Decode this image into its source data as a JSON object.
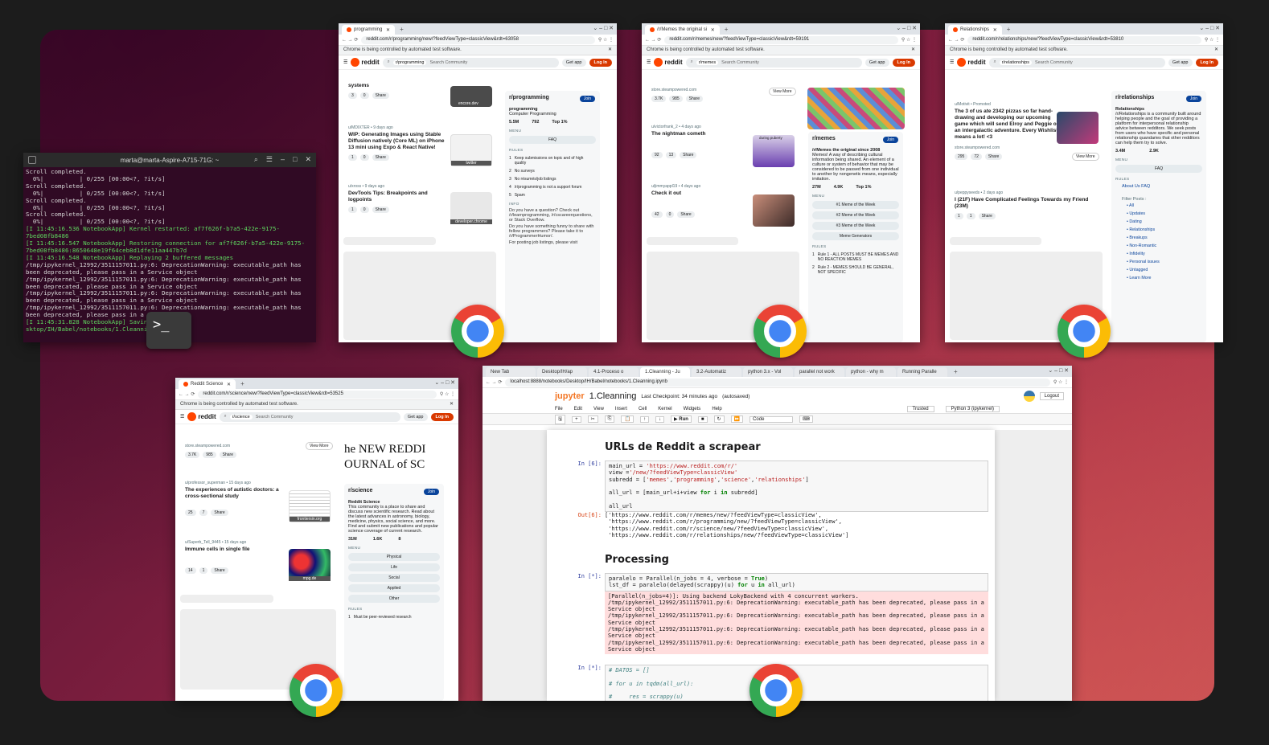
{
  "terminal": {
    "title": "marta@marta-Aspire-A715-71G: ~",
    "lines": [
      "Scroll completed.",
      "  0%|          | 0/255 [00:00<?, ?it/s]",
      "Scroll completed.",
      "  0%|          | 0/255 [00:00<?, ?it/s]",
      "Scroll completed.",
      "  0%|          | 0/255 [00:00<?, ?it/s]",
      "Scroll completed.",
      "  0%|          | 0/255 [00:00<?, ?it/s]",
      "[I 11:45:16.536 NotebookApp] Kernel restarted: af7f626f-b7a5-422e-9175-7bed08fb8486",
      "[I 11:45:16.547 NotebookApp] Restoring connection for af7f626f-b7a5-422e-9175-7bed08fb8486:8650648e19f64ceb8d1dfe11aa447b7d",
      "[I 11:45:16.548 NotebookApp] Replaying 2 buffered messages",
      "/tmp/ipykernel_12992/3511157011.py:6: DeprecationWarning: executable_path has been deprecated, please pass in a Service object",
      "/tmp/ipykernel_12992/3511157011.py:6: DeprecationWarning: executable_path has been deprecated, please pass in a Service object",
      "/tmp/ipykernel_12992/3511157011.py:6: DeprecationWarning: executable_path has been deprecated, please pass in a Service object",
      "/tmp/ipykernel_12992/3511157011.py:6: DeprecationWarning: executable_path has been deprecated, please pass in a Se",
      "[I 11:45:31.828 NotebookApp] Saving          sktop/IH/Babel/notebooks/1.Cleanning.ipynb"
    ],
    "icon": "terminal-icon"
  },
  "common": {
    "infobar": "Chrome is being controlled by automated test software.",
    "reddit": "reddit",
    "search": "Search Community",
    "getapp": "Get app",
    "login": "Log In",
    "join": "Join",
    "share": "Share",
    "menu": "MENU",
    "rules": "RULES",
    "faq": "FAQ"
  },
  "programming": {
    "tab": "programming",
    "url": "reddit.com/r/programming/new/?feedViewType=classicView&rdt=63058",
    "chip": "r/programming",
    "post0_title": "systems",
    "post0_counts": [
      "3",
      "0"
    ],
    "post0_thumb": "encore.dev",
    "post1_meta": "u/MDIXTER • 9 days ago",
    "post1_title": "WIP: Generating Images using Stable Diffusion natively (Core ML) on iPhone 13 mini using Expo & React Native!",
    "post1_counts": [
      "1",
      "0"
    ],
    "post1_thumb": "twitter",
    "post2_meta": "u/xross • 9 days ago",
    "post2_title": "DevTools Tips: Breakpoints and logpoints",
    "post2_counts": [
      "1",
      "0"
    ],
    "post2_thumb": "developer.chrome",
    "side_title": "r/programming",
    "side_name": "programming",
    "side_desc": "Computer Programming",
    "members": "5.5M",
    "online": "792",
    "rank": "Top 1%",
    "rules": [
      "Keep submissions on topic and of high quality",
      "No surveys",
      "No résumés/job listings",
      "/r/programming is not a support forum",
      "Spam"
    ],
    "info_head": "INFO",
    "info1": "Do you have a question? Check out /r/learnprogramming, /r/cscareerquestions, or Stack Overflow.",
    "info2": "Do you have something funny to share with fellow programmers? Please take it to /r/ProgrammerHumor/.",
    "info3": "For posting job listings, please visit"
  },
  "memes": {
    "tab": "/r/Memes the original si",
    "url": "reddit.com/r/memes/new/?feedViewType=classicView&rdt=59191",
    "chip": "r/memes",
    "domain": "store.steampowered.com",
    "viewmore": "View More",
    "post0_counts": [
      "3.7K",
      "985"
    ],
    "post1_meta": "u/victorfrank_2 • 4 days ago",
    "post1_title": "The nightman cometh",
    "post1_counts": [
      "92",
      "13"
    ],
    "post1_thumb": "during puberty",
    "post2_meta": "u/jimmyappl19 • 4 days ago",
    "post2_title": "Check it out",
    "post2_counts": [
      "42",
      "0"
    ],
    "side_title": "r/memes",
    "side_name": "/r/Memes the original since 2008",
    "side_desc": "Memes! A way of describing cultural information being shared. An element of a culture or system of behavior that may be considered to be passed from one individual to another by nongenetic means, especially imitation.",
    "members": "27M",
    "online": "4.9K",
    "rank": "Top 1%",
    "menu_items": [
      "#1 Meme of the Week",
      "#2 Meme of the Week",
      "#3 Meme of the Week",
      "Meme Generators"
    ],
    "rules": [
      "Rule 1 - ALL POSTS MUST BE MEMES AND NO REACTION MEMES",
      "Rule 2 - MEMES SHOULD BE GENERAL, NOT SPECIFIC"
    ]
  },
  "relationships": {
    "tab": "Relationships",
    "url": "reddit.com/r/relationships/new/?feedViewType=classicView&rdt=53810",
    "chip": "r/relationships",
    "post1_meta": "u/Motivit • Promoted",
    "post1_title": "The 3 of us ate 2342 pizzas so far hand-drawing and developing our upcoming game which will send Elroy and Peggie on an intergalactic adventure. Every Wishlist means a lot! <3",
    "domain": "store.steampowered.com",
    "viewmore": "View More",
    "post1_counts": [
      "295",
      "72"
    ],
    "post2_meta": "u/peppyseeds • 2 days ago",
    "post2_title": "I (21F) Have Complicated Feelings Towards my Friend (23M)",
    "post2_counts": [
      "1",
      "1"
    ],
    "side_title": "r/relationships",
    "side_name": "Relationships",
    "side_desc": "/r/Relationships is a community built around helping people and the goal of providing a platform for interpersonal relationship advice between redditors. We seek posts from users who have specific and personal relationship quandaries that other redditors can help them try to solve.",
    "members": "3.4M",
    "online": "2.9K",
    "about": "About Us FAQ",
    "filter_head": "Filter Posts :",
    "filters": [
      "All",
      "Updates",
      "Dating",
      "Relationships",
      "Breakups",
      "Non-Romantic",
      "Infidelity",
      "Personal issues",
      "Untagged",
      "Learn More"
    ]
  },
  "science": {
    "tab": "Reddit Science",
    "url": "reddit.com/r/science/new/?feedViewType=classicView&rdt=53525",
    "chip": "r/science",
    "domain": "store.steampowered.com",
    "viewmore": "View More",
    "post0_counts": [
      "3.7K",
      "985"
    ],
    "post1_meta": "u/professor_superman • 15 days ago",
    "post1_title": "The experiences of autistic doctors: a cross-sectional study",
    "post1_counts": [
      "25",
      "7"
    ],
    "post1_thumb": "frontiersin.org",
    "post2_meta": "u/Superb_Tell_9445 • 15 days ago",
    "post2_title": "Immune cells in single file",
    "post2_counts": [
      "14",
      "1"
    ],
    "post2_thumb": "mpg.de",
    "banner": "he NEW REDDI OURNAL of SC",
    "side_title": "r/science",
    "side_name": "Reddit Science",
    "side_desc": "This community is a place to share and discuss new scientific research. Read about the latest advances in astronomy, biology, medicine, physics, social science, and more. Find and submit new publications and popular science coverage of current research.",
    "members": "31M",
    "online": "1.6K",
    "rank": "8",
    "menu_items": [
      "Physical",
      "Life",
      "Social",
      "Applied",
      "Other"
    ],
    "rule1": "Must be peer-reviewed research"
  },
  "jupyter": {
    "tabs": [
      "New Tab",
      "Desktop/IH/ap",
      "4.1-Proceso o",
      "1.Cleanning - Ju",
      "3.2-Automatiz",
      "python 3.x - Vol",
      "parallel not work",
      "python - why m",
      "Running Paralle"
    ],
    "url": "localhost:8888/notebooks/Desktop/IH/Babel/notebooks/1.Cleanning.ipynb",
    "brand": "jupyter",
    "notebook": "1.Cleanning",
    "checkpoint": "Last Checkpoint: 34 minutes ago",
    "autosaved": "(autosaved)",
    "logout": "Logout",
    "menu": [
      "File",
      "Edit",
      "View",
      "Insert",
      "Cell",
      "Kernel",
      "Widgets",
      "Help"
    ],
    "trusted": "Trusted",
    "kernel": "Python 3 (ipykernel)",
    "run": "Run",
    "celltype": "Code",
    "h1": "URLs de Reddit a scrapear",
    "in6": "In [6]:",
    "out6": "Out[6]:",
    "code6": "main_url = 'https://www.reddit.com/r/'\nview ='/new/?feedViewType=classicView'\nsubredd = ['memes','programming','science','relationships']\n\nall_url = [main_url+i+view for i in subredd]\n\nall_url",
    "output6": "['https://www.reddit.com/r/memes/new/?feedViewType=classicView',\n 'https://www.reddit.com/r/programming/new/?feedViewType=classicView',\n 'https://www.reddit.com/r/science/new/?feedViewType=classicView',\n 'https://www.reddit.com/r/relationships/new/?feedViewType=classicView']",
    "h2": "Processing",
    "instar": "In [*]:",
    "code7": "paralelo = Parallel(n_jobs = 4, verbose = True)\nlst_df = paralelo(delayed(scrappy)(u) for u in all_url)",
    "stderr": "[Parallel(n_jobs=4)]: Using backend LokyBackend with 4 concurrent workers.\n/tmp/ipykernel_12992/3511157011.py:6: DeprecationWarning: executable_path has been deprecated, please pass in a Service object\n/tmp/ipykernel_12992/3511157011.py:6: DeprecationWarning: executable_path has been deprecated, please pass in a Service object\n/tmp/ipykernel_12992/3511157011.py:6: DeprecationWarning: executable_path has been deprecated, please pass in a Service object\n/tmp/ipykernel_12992/3511157011.py:6: DeprecationWarning: executable_path has been deprecated, please pass in a Service object",
    "code8": "# DATOS = []\n\n# for u in tqdm(all_url):\n\n#     res = scrappy(u)"
  }
}
